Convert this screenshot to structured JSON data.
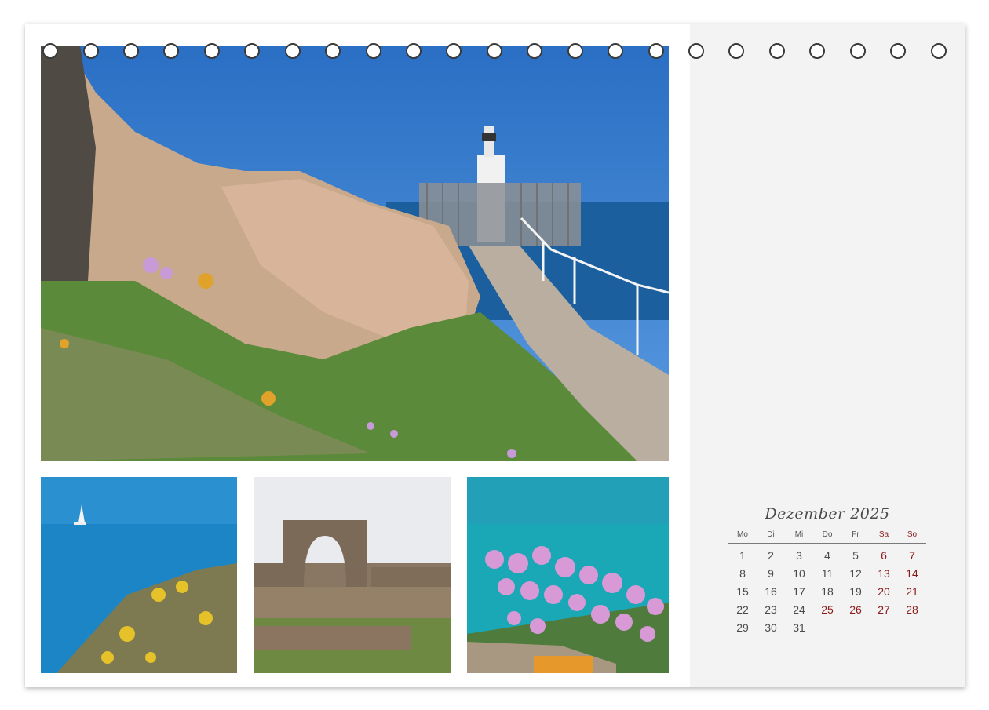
{
  "calendar": {
    "month_title": "Dezember 2025",
    "weekday_headers": [
      "Mo",
      "Di",
      "Mi",
      "Do",
      "Fr",
      "Sa",
      "So"
    ],
    "days": [
      {
        "label": "1",
        "red": false
      },
      {
        "label": "2",
        "red": false
      },
      {
        "label": "3",
        "red": false
      },
      {
        "label": "4",
        "red": false
      },
      {
        "label": "5",
        "red": false
      },
      {
        "label": "6",
        "red": true
      },
      {
        "label": "7",
        "red": true
      },
      {
        "label": "8",
        "red": false
      },
      {
        "label": "9",
        "red": false
      },
      {
        "label": "10",
        "red": false
      },
      {
        "label": "11",
        "red": false
      },
      {
        "label": "12",
        "red": false
      },
      {
        "label": "13",
        "red": true
      },
      {
        "label": "14",
        "red": true
      },
      {
        "label": "15",
        "red": false
      },
      {
        "label": "16",
        "red": false
      },
      {
        "label": "17",
        "red": false
      },
      {
        "label": "18",
        "red": false
      },
      {
        "label": "19",
        "red": false
      },
      {
        "label": "20",
        "red": true
      },
      {
        "label": "21",
        "red": true
      },
      {
        "label": "22",
        "red": false
      },
      {
        "label": "23",
        "red": false
      },
      {
        "label": "24",
        "red": false
      },
      {
        "label": "25",
        "red": true
      },
      {
        "label": "26",
        "red": true
      },
      {
        "label": "27",
        "red": true
      },
      {
        "label": "28",
        "red": true
      },
      {
        "label": "29",
        "red": false
      },
      {
        "label": "30",
        "red": false
      },
      {
        "label": "31",
        "red": false
      }
    ]
  },
  "colors": {
    "holiday_red": "#8b1a1a",
    "sky_blue": "#2f78c8",
    "sea_blue": "#1a6fb0",
    "turquoise": "#18a9b8"
  },
  "photos": {
    "main": "lighthouse-coast-photo",
    "small": [
      "sailboat-cliff-photo",
      "stone-arch-ruin-photo",
      "pink-thrift-flowers-photo"
    ]
  }
}
